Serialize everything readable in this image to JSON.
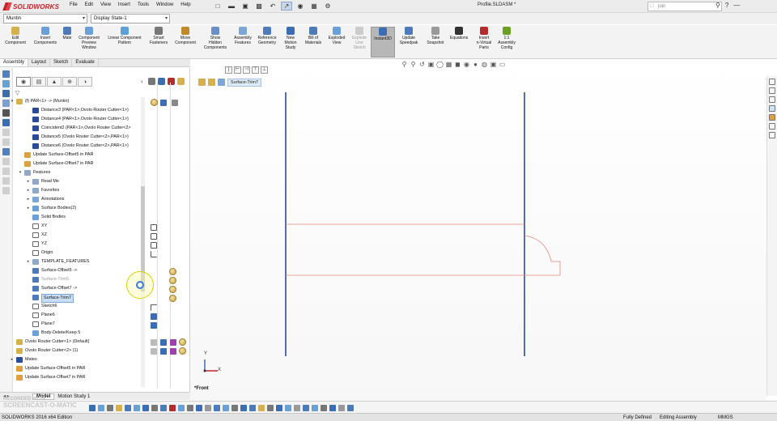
{
  "app": {
    "logo_text": "SOLIDWORKS",
    "document_title": "Profile.SLDASM *",
    "search_placeholder": "join",
    "menu": [
      "File",
      "Edit",
      "View",
      "Insert",
      "Tools",
      "Window",
      "Help"
    ]
  },
  "config": {
    "component_select": "Muntin",
    "display_state": "Display State-1"
  },
  "command_manager": {
    "buttons": [
      {
        "label": "Edit\nComponent",
        "icon": "edit-component-icon",
        "state": "normal"
      },
      {
        "label": "Insert\nComponents",
        "icon": "insert-components-icon",
        "state": "normal"
      },
      {
        "label": "Mate",
        "icon": "mate-icon",
        "state": "normal"
      },
      {
        "label": "Component\nPreview\nWindow",
        "icon": "component-preview-icon",
        "state": "normal"
      },
      {
        "label": "Linear Component\nPattern",
        "icon": "linear-pattern-icon",
        "state": "normal"
      },
      {
        "label": "Smart\nFasteners",
        "icon": "smart-fasteners-icon",
        "state": "normal"
      },
      {
        "label": "Move\nComponent",
        "icon": "move-component-icon",
        "state": "normal"
      },
      {
        "label": "Show\nHidden\nComponents",
        "icon": "show-hidden-icon",
        "state": "normal"
      },
      {
        "label": "Assembly\nFeatures",
        "icon": "assembly-features-icon",
        "state": "normal"
      },
      {
        "label": "Reference\nGeometry",
        "icon": "reference-geometry-icon",
        "state": "normal"
      },
      {
        "label": "New\nMotion\nStudy",
        "icon": "motion-study-icon",
        "state": "normal"
      },
      {
        "label": "Bill of\nMaterials",
        "icon": "bom-icon",
        "state": "normal"
      },
      {
        "label": "Exploded\nView",
        "icon": "exploded-view-icon",
        "state": "normal"
      },
      {
        "label": "Explode\nLine\nSketch",
        "icon": "explode-line-icon",
        "state": "disabled"
      },
      {
        "label": "Instant3D",
        "icon": "instant3d-icon",
        "state": "active"
      },
      {
        "label": "Update\nSpeedpak",
        "icon": "speedpak-icon",
        "state": "normal"
      },
      {
        "label": "Take\nSnapshot",
        "icon": "snapshot-icon",
        "state": "normal"
      },
      {
        "label": "Equations",
        "icon": "equations-icon",
        "state": "normal"
      },
      {
        "label": "Insert\nn-Virtual\nParts",
        "icon": "virtual-parts-icon",
        "state": "normal"
      },
      {
        "label": "1:1\nAssembly\nConfig",
        "icon": "assembly-config-icon",
        "state": "normal"
      }
    ]
  },
  "tabs": [
    "Assembly",
    "Layout",
    "Sketch",
    "Evaluate"
  ],
  "tree": {
    "rows": [
      {
        "label": "(f) PAR<1> -> (Muntin)",
        "indent": 0,
        "toggle": "▾",
        "kind": "assembly",
        "state": "normal"
      },
      {
        "label": "Distance3 (PAR<1>,Ovolo Router Cutter<1>)",
        "indent": 2,
        "toggle": "",
        "kind": "mate",
        "state": "normal"
      },
      {
        "label": "Distance4 (PAR<1>,Ovolo Router Cutter<1>)",
        "indent": 2,
        "toggle": "",
        "kind": "mate",
        "state": "normal"
      },
      {
        "label": "Coincident2 (PAR<1>,Ovolo Router Cutter<2>",
        "indent": 2,
        "toggle": "",
        "kind": "coincident",
        "state": "normal"
      },
      {
        "label": "Distance5 (Ovolo Router Cutter<2>,PAR<1>)",
        "indent": 2,
        "toggle": "",
        "kind": "mate",
        "state": "normal"
      },
      {
        "label": "Distance6 (Ovolo Router Cutter<2>,PAR<1>)",
        "indent": 2,
        "toggle": "",
        "kind": "mate",
        "state": "normal"
      },
      {
        "label": "Update Surface-Offset5 in PAR",
        "indent": 1,
        "toggle": "",
        "kind": "update",
        "state": "normal"
      },
      {
        "label": "Update Surface-Offset7 in PAR",
        "indent": 1,
        "toggle": "",
        "kind": "update",
        "state": "normal"
      },
      {
        "label": "Features",
        "indent": 1,
        "toggle": "▾",
        "kind": "folder",
        "state": "normal"
      },
      {
        "label": "Read Me",
        "indent": 2,
        "toggle": "▸",
        "kind": "folder",
        "state": "normal"
      },
      {
        "label": "Favorites",
        "indent": 2,
        "toggle": "▸",
        "kind": "folder",
        "state": "normal"
      },
      {
        "label": "Annotations",
        "indent": 2,
        "toggle": "▸",
        "kind": "annotation",
        "state": "normal"
      },
      {
        "label": "Surface Bodies(2)",
        "indent": 2,
        "toggle": "▸",
        "kind": "body",
        "state": "normal"
      },
      {
        "label": "Solid Bodies",
        "indent": 2,
        "toggle": "",
        "kind": "body",
        "state": "normal"
      },
      {
        "label": "XY",
        "indent": 2,
        "toggle": "",
        "kind": "plane",
        "state": "normal"
      },
      {
        "label": "XZ",
        "indent": 2,
        "toggle": "",
        "kind": "plane",
        "state": "normal"
      },
      {
        "label": "YZ",
        "indent": 2,
        "toggle": "",
        "kind": "plane",
        "state": "normal"
      },
      {
        "label": "Origin",
        "indent": 2,
        "toggle": "",
        "kind": "origin",
        "state": "normal"
      },
      {
        "label": "TEMPLATE_FEATURES",
        "indent": 2,
        "toggle": "▸",
        "kind": "folder",
        "state": "normal"
      },
      {
        "label": "Surface-Offset5 ->",
        "indent": 2,
        "toggle": "",
        "kind": "surface",
        "state": "normal"
      },
      {
        "label": "Surface-Trim5",
        "indent": 2,
        "toggle": "",
        "kind": "surface",
        "state": "grey"
      },
      {
        "label": "Surface-Offset7 ->",
        "indent": 2,
        "toggle": "",
        "kind": "surface",
        "state": "normal"
      },
      {
        "label": "Surface-Trim7",
        "indent": 2,
        "toggle": "",
        "kind": "surface",
        "state": "sel"
      },
      {
        "label": "Sketch6",
        "indent": 2,
        "toggle": "",
        "kind": "sketch",
        "state": "normal"
      },
      {
        "label": "Plane6",
        "indent": 2,
        "toggle": "",
        "kind": "plane",
        "state": "normal"
      },
      {
        "label": "Plane7",
        "indent": 2,
        "toggle": "",
        "kind": "plane",
        "state": "normal"
      },
      {
        "label": "Body-Delete/Keep 5",
        "indent": 2,
        "toggle": "",
        "kind": "body",
        "state": "normal"
      },
      {
        "label": "Ovolo Router Cutter<1> (Default)",
        "indent": 0,
        "toggle": "",
        "kind": "part",
        "state": "normal"
      },
      {
        "label": "Ovolo Router Cutter<2> (1)",
        "indent": 0,
        "toggle": "",
        "kind": "part",
        "state": "normal"
      },
      {
        "label": "Mates",
        "indent": 0,
        "toggle": "▸",
        "kind": "mates",
        "state": "normal"
      },
      {
        "label": "Update Surface-Offset5 in PAR",
        "indent": 0,
        "toggle": "",
        "kind": "update",
        "state": "normal"
      },
      {
        "label": "Update Surface-Offset7 in PAR",
        "indent": 0,
        "toggle": "",
        "kind": "update",
        "state": "normal"
      }
    ]
  },
  "breadcrumb": {
    "label": "Surface-Trim7"
  },
  "graphics": {
    "view_label": "*Front",
    "triad_x": "X",
    "triad_y": "Y"
  },
  "bottom_tabs": [
    "Model",
    "Motion Study 1"
  ],
  "watermark": "RECORDED WITH\nSCREENCAST-O-MATIC",
  "status": {
    "version": "SOLIDWORKS 2016 x64 Edition",
    "definition": "Fully Defined",
    "mode": "Editing Assembly",
    "units": "MMGS"
  },
  "colors": {
    "accent": "#c8202a",
    "selection": "#c9def5",
    "model_edge": "#2a4a9a",
    "sketch_line": "#e48a7a"
  }
}
